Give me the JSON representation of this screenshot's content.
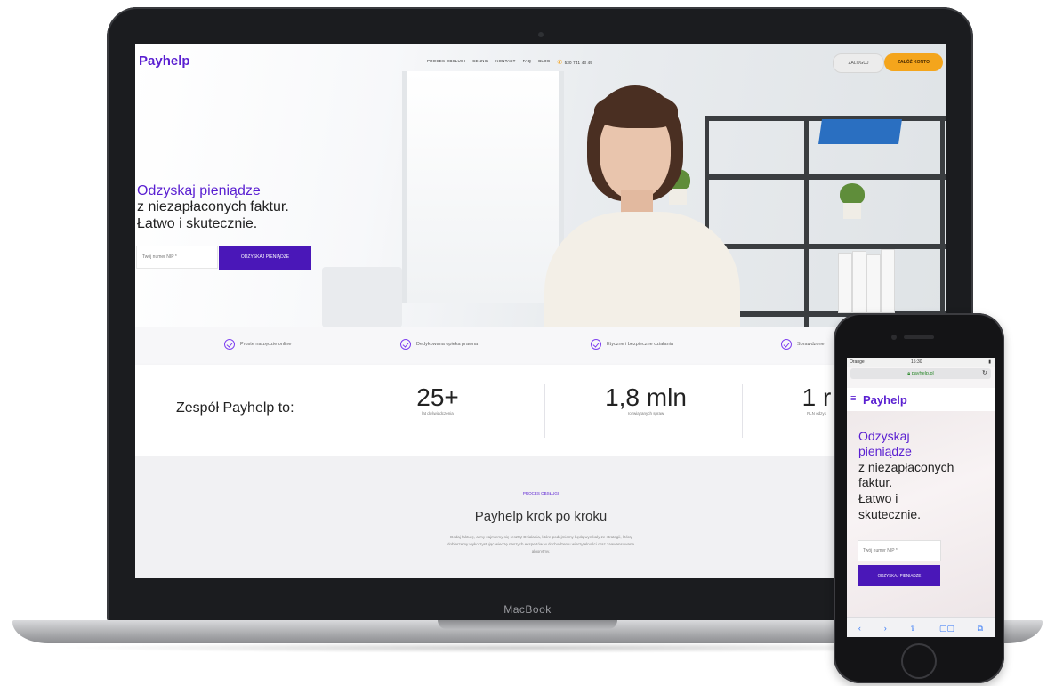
{
  "laptop": {
    "brand_label": "MacBook",
    "site": {
      "nav": {
        "logo": "Payhelp",
        "links": [
          "PROCES OBSŁUGI",
          "CENNIK",
          "KONTAKT",
          "FAQ",
          "BLOG"
        ],
        "phone": "530 741 43 49",
        "login_label": "ZALOGUJ",
        "register_label": "ZAŁÓŻ KONTO"
      },
      "hero": {
        "headline_purple": "Odzyskaj pieniądze",
        "headline_line2": "z niezapłaconych faktur.",
        "headline_line3": "Łatwo i skutecznie.",
        "nip_placeholder": "Twój numer NIP *",
        "cta_label": "ODZYSKAJ PIENIĄDZE"
      },
      "features": [
        "Proste narzędzie online",
        "Dedykowana opieka prawna",
        "Etyczne i bezpieczne działania",
        "Sprawdzone"
      ],
      "stats": {
        "title": "Zespół Payhelp to:",
        "items": [
          {
            "value": "25+",
            "label": "lat doświadczenia"
          },
          {
            "value": "1,8 mln",
            "label": "rozwiązanych spraw"
          },
          {
            "value": "1 r",
            "label": "PLN odzys"
          }
        ]
      },
      "process": {
        "label": "PROCES OBSŁUGI",
        "title": "Payhelp krok po kroku",
        "text": "Dodaj fakturę, a my zajmiemy się resztą! Działania, które podejmiemy będą wynikały ze strategii, którą dobierzemy wykorzystując wiedzę naszych ekspertów w dochodzeniu wierzytelności oraz zaawansowane algorytmy."
      }
    }
  },
  "phone": {
    "status": {
      "carrier": "Orange",
      "time": "15:30",
      "battery": "▮"
    },
    "url": "payhelp.pl",
    "reload_icon": "↻",
    "logo": "Payhelp",
    "hamburger": "≡",
    "headline_lines_purple": [
      "Odzyskaj",
      "pieniądze"
    ],
    "headline_lines_dark": [
      "z niezapłaconych",
      "faktur.",
      "Łatwo i",
      "skutecznie."
    ],
    "nip_placeholder": "Twój numer NIP *",
    "cta_label": "ODZYSKAJ PIENIĄDZE",
    "toolbar": [
      "‹",
      "›",
      "⇪",
      "▢▢",
      "⧉"
    ]
  },
  "colors": {
    "brand_purple": "#5a1fd1",
    "cta_purple": "#4a17b8",
    "accent_orange": "#f4a51c"
  }
}
